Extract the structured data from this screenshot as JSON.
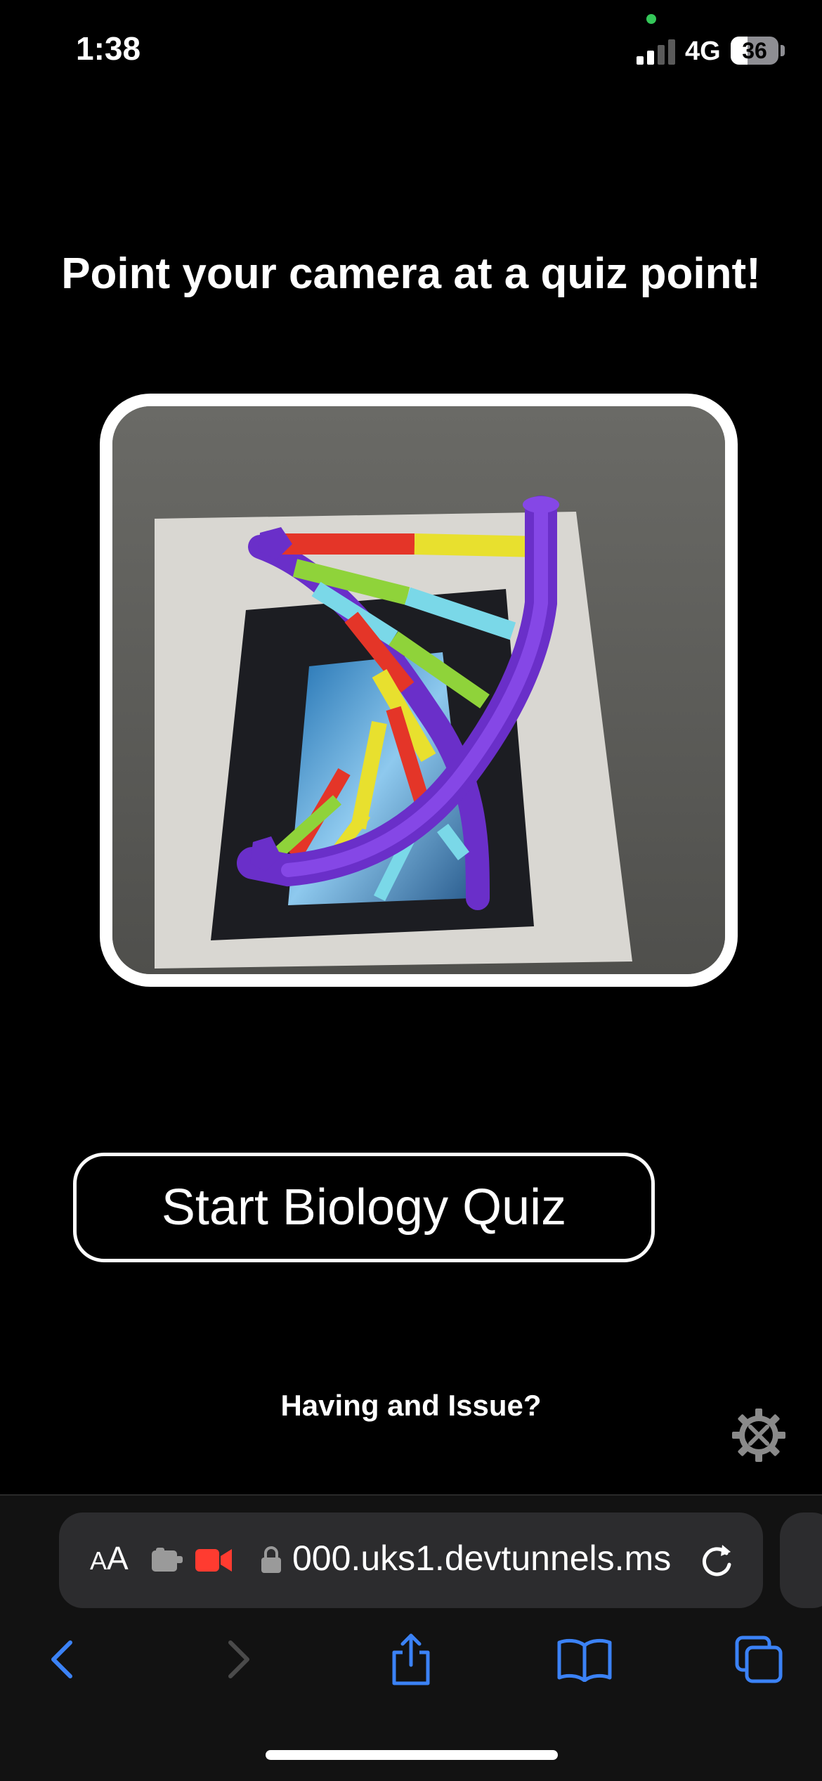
{
  "status_bar": {
    "time": "1:38",
    "network": "4G",
    "battery_percent": 36
  },
  "headline": "Point your camera at a quiz point!",
  "camera_view": {
    "description_icon": "dna-double-helix-ar-model"
  },
  "start_button": {
    "label": "Start Biology Quiz"
  },
  "issue_link": {
    "label": "Having and Issue?"
  },
  "settings": {
    "icon": "gear-wrench-icon"
  },
  "browser": {
    "text_size_label_small": "A",
    "text_size_label_large": "A",
    "url": "000.uks1.devtunnels.ms",
    "toolbar": [
      "back",
      "forward",
      "share",
      "bookmarks",
      "tabs"
    ]
  },
  "colors": {
    "background": "#000000",
    "accent_blue": "#3b82f6",
    "recording_red": "#ff3b30",
    "camera_dot_green": "#34c759"
  }
}
